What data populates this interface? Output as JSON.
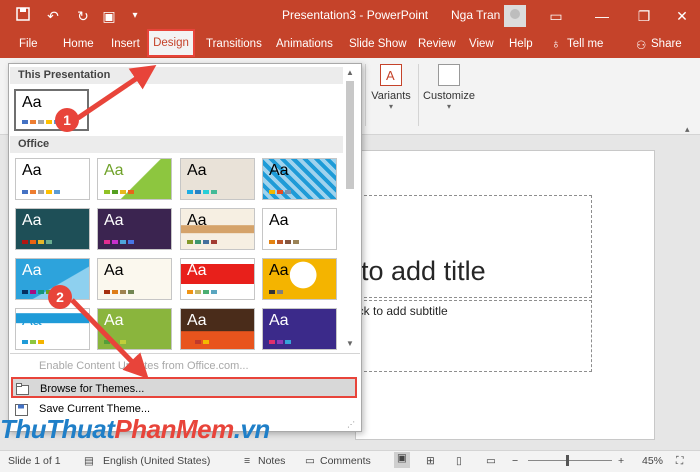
{
  "window": {
    "doc_title": "Presentation3 - PowerPoint",
    "user_name": "Nga Tran",
    "quick_access": [
      "save-icon",
      "undo-icon",
      "redo-icon",
      "present-icon",
      "customize-icon"
    ],
    "accent": "#c5432a"
  },
  "tabs": [
    {
      "label": "File"
    },
    {
      "label": "Home"
    },
    {
      "label": "Insert"
    },
    {
      "label": "Design"
    },
    {
      "label": "Transitions"
    },
    {
      "label": "Animations"
    },
    {
      "label": "Slide Show"
    },
    {
      "label": "Review"
    },
    {
      "label": "View"
    },
    {
      "label": "Help"
    }
  ],
  "tell_me": "Tell me",
  "share": "Share",
  "ribbon": {
    "variants": "Variants",
    "customize": "Customize"
  },
  "themes_panel": {
    "section_this": "This Presentation",
    "section_office": "Office",
    "menu": {
      "enable_updates": "Enable Content Updates from Office.com...",
      "browse": "Browse for Themes...",
      "save": "Save Current Theme..."
    }
  },
  "slide": {
    "title_placeholder": "to add title",
    "subtitle_placeholder": "ick to add subtitle"
  },
  "status": {
    "slide_of": "Slide 1 of 1",
    "language": "English (United States)",
    "notes": "Notes",
    "comments": "Comments",
    "zoom": "45%"
  },
  "annotations": {
    "step1": "1",
    "step2": "2"
  },
  "watermark": {
    "part1": "ThuThuat",
    "part2": "PhanMem",
    "part3": ".vn"
  }
}
